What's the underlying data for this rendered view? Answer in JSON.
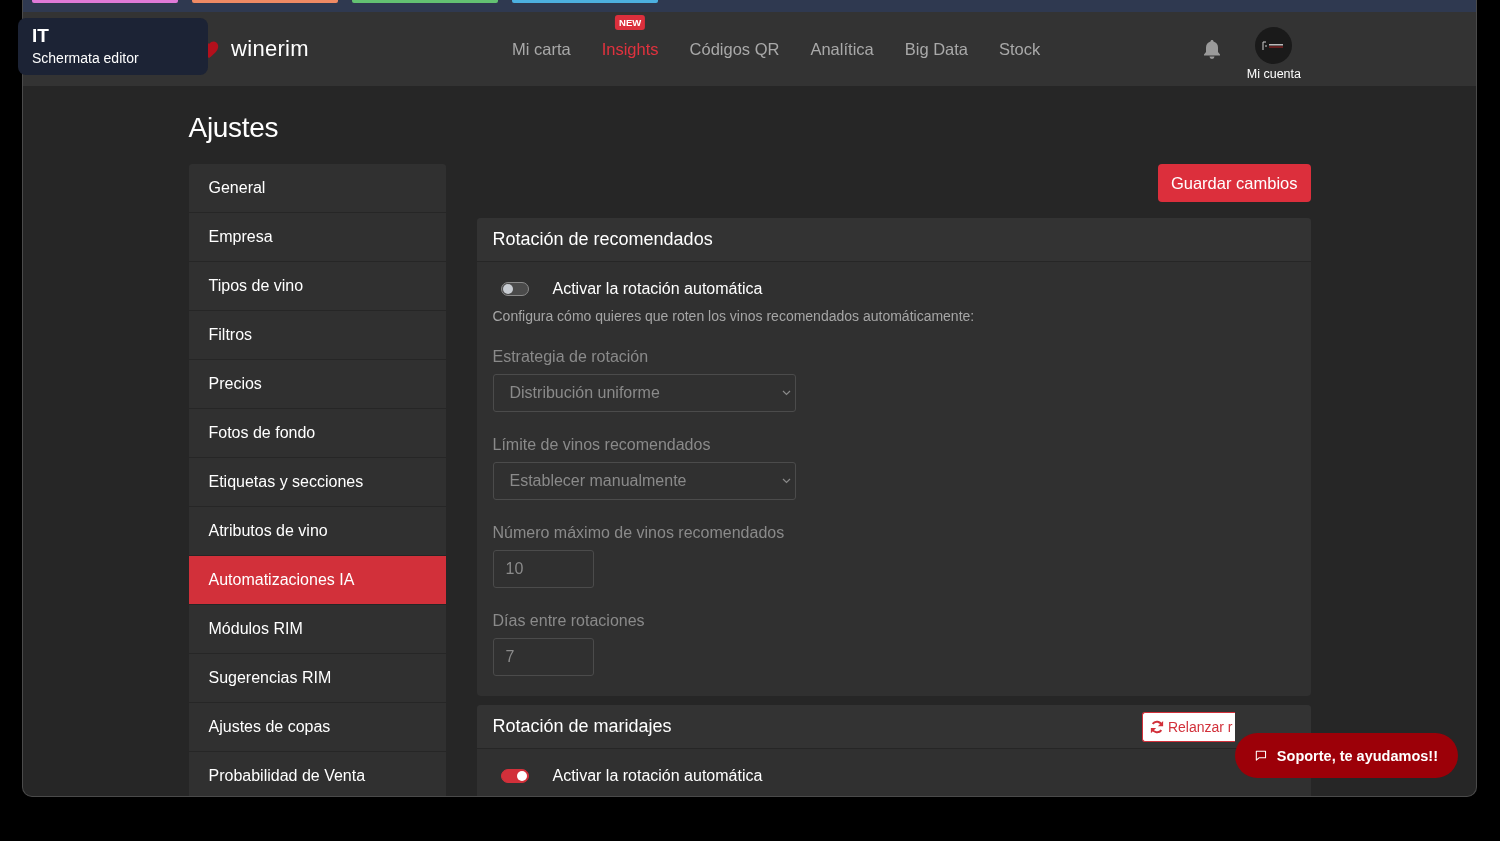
{
  "tab_strip": [
    {
      "color": "#e07ad8"
    },
    {
      "color": "#ef8a64"
    },
    {
      "color": "#63c172"
    },
    {
      "color": "#4cb0e0"
    }
  ],
  "tooltip": {
    "title": "IT",
    "subtitle": "Schermata editor"
  },
  "brand": {
    "name": "winerim"
  },
  "nav": [
    {
      "label": "Mi carta",
      "selected": false
    },
    {
      "label": "Insights",
      "selected": true,
      "badge": "NEW"
    },
    {
      "label": "Códigos QR",
      "selected": false
    },
    {
      "label": "Analítica",
      "selected": false
    },
    {
      "label": "Big Data",
      "selected": false
    },
    {
      "label": "Stock",
      "selected": false
    }
  ],
  "account": {
    "label": "Mi cuenta"
  },
  "page_title": "Ajustes",
  "sidebar": [
    {
      "label": "General",
      "selected": false
    },
    {
      "label": "Empresa",
      "selected": false
    },
    {
      "label": "Tipos de vino",
      "selected": false
    },
    {
      "label": "Filtros",
      "selected": false
    },
    {
      "label": "Precios",
      "selected": false
    },
    {
      "label": "Fotos de fondo",
      "selected": false
    },
    {
      "label": "Etiquetas y secciones",
      "selected": false
    },
    {
      "label": "Atributos de vino",
      "selected": false
    },
    {
      "label": "Automatizaciones IA",
      "selected": true
    },
    {
      "label": "Módulos RIM",
      "selected": false
    },
    {
      "label": "Sugerencias RIM",
      "selected": false
    },
    {
      "label": "Ajustes de copas",
      "selected": false
    },
    {
      "label": "Probabilidad de Venta",
      "selected": false
    }
  ],
  "save_button": "Guardar cambios",
  "cards": [
    {
      "title": "Rotación de recomendados",
      "toggle": {
        "label": "Activar la rotación automática",
        "on": false
      },
      "description": "Configura cómo quieres que roten los vinos recomendados automáticamente:",
      "fields": [
        {
          "kind": "select",
          "label": "Estrategia de rotación",
          "value": "Distribución uniforme"
        },
        {
          "kind": "select",
          "label": "Límite de vinos recomendados",
          "value": "Establecer manualmente"
        },
        {
          "kind": "number",
          "label": "Número máximo de vinos recomendados",
          "value": "10"
        },
        {
          "kind": "number",
          "label": "Días entre rotaciones",
          "value": "7"
        }
      ]
    },
    {
      "title": "Rotación de maridajes",
      "action": "Relanzar r",
      "toggle": {
        "label": "Activar la rotación automática",
        "on": true
      }
    }
  ],
  "support": {
    "label": "Soporte, te ayudamos!!"
  }
}
